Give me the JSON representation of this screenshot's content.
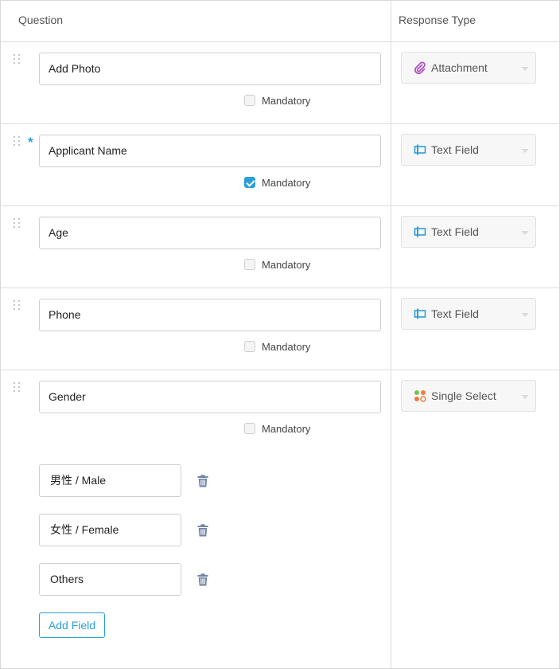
{
  "header": {
    "question_label": "Question",
    "response_type_label": "Response Type"
  },
  "mandatory_label": "Mandatory",
  "rows": [
    {
      "question": "Add Photo",
      "required": false,
      "mandatory_checked": false,
      "response_type": "Attachment",
      "response_icon": "paperclip-icon"
    },
    {
      "question": "Applicant Name",
      "required": true,
      "required_marker": "*",
      "mandatory_checked": true,
      "response_type": "Text Field",
      "response_icon": "text-field-icon"
    },
    {
      "question": "Age",
      "required": false,
      "mandatory_checked": false,
      "response_type": "Text Field",
      "response_icon": "text-field-icon"
    },
    {
      "question": "Phone",
      "required": false,
      "mandatory_checked": false,
      "response_type": "Text Field",
      "response_icon": "text-field-icon"
    },
    {
      "question": "Gender",
      "required": false,
      "mandatory_checked": false,
      "response_type": "Single Select",
      "response_icon": "single-select-icon"
    }
  ],
  "options": [
    "男性 / Male",
    "女性 / Female",
    "Others"
  ],
  "add_field_label": "Add Field",
  "colors": {
    "accent": "#2a9fd8",
    "attachment_icon": "#b04fc6",
    "text_field_icon": "#2a9fd8",
    "single_select_icon": "#ef7b3e",
    "trash_icon": "#6f85a6",
    "border": "#dcdcdc"
  }
}
